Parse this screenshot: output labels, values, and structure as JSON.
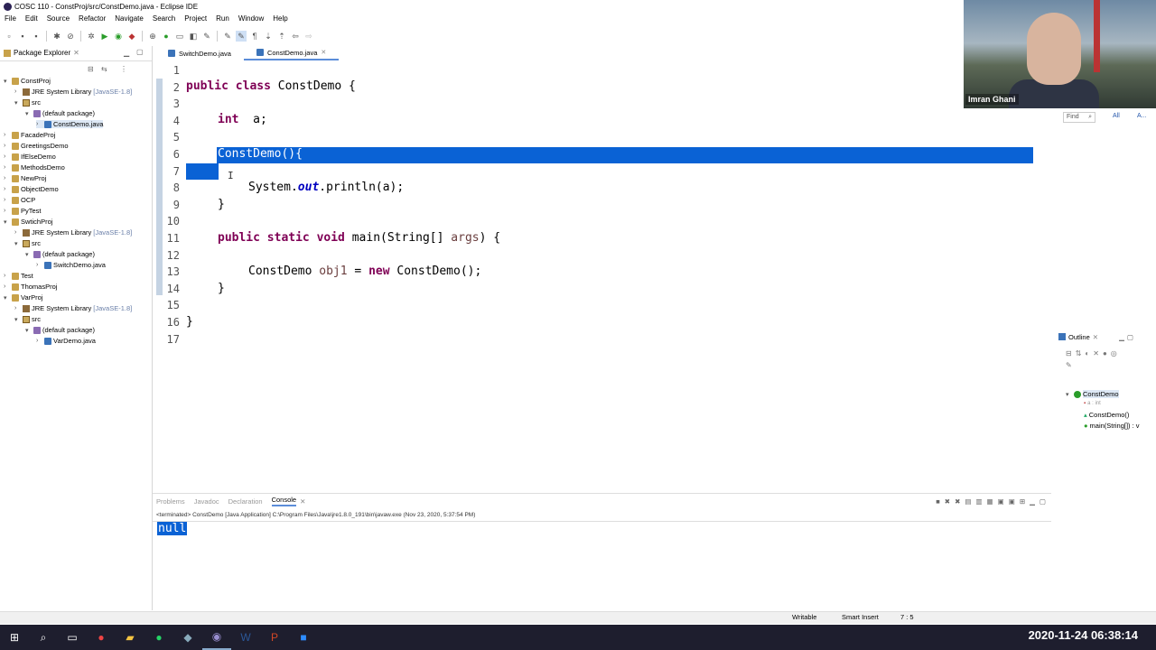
{
  "window": {
    "title": "COSC 110 - ConstProj/src/ConstDemo.java - Eclipse IDE"
  },
  "menu": [
    "File",
    "Edit",
    "Source",
    "Refactor",
    "Navigate",
    "Search",
    "Project",
    "Run",
    "Window",
    "Help"
  ],
  "package_explorer": {
    "title": "Package Explorer",
    "items": [
      {
        "label": "ConstProj",
        "extra": ""
      },
      {
        "label": "JRE System Library",
        "extra": "[JavaSE-1.8]"
      },
      {
        "label": "src",
        "extra": ""
      },
      {
        "label": "(default package)",
        "extra": ""
      },
      {
        "label": "ConstDemo.java",
        "extra": ""
      },
      {
        "label": "FacadeProj",
        "extra": ""
      },
      {
        "label": "GreetingsDemo",
        "extra": ""
      },
      {
        "label": "IfElseDemo",
        "extra": ""
      },
      {
        "label": "MethodsDemo",
        "extra": ""
      },
      {
        "label": "NewProj",
        "extra": ""
      },
      {
        "label": "ObjectDemo",
        "extra": ""
      },
      {
        "label": "OCP",
        "extra": ""
      },
      {
        "label": "PyTest",
        "extra": ""
      },
      {
        "label": "SwtichProj",
        "extra": ""
      },
      {
        "label": "JRE System Library",
        "extra": "[JavaSE-1.8]"
      },
      {
        "label": "src",
        "extra": ""
      },
      {
        "label": "(default package)",
        "extra": ""
      },
      {
        "label": "SwitchDemo.java",
        "extra": ""
      },
      {
        "label": "Test",
        "extra": ""
      },
      {
        "label": "ThomasProj",
        "extra": ""
      },
      {
        "label": "VarProj",
        "extra": ""
      },
      {
        "label": "JRE System Library",
        "extra": "[JavaSE-1.8]"
      },
      {
        "label": "src",
        "extra": ""
      },
      {
        "label": "(default package)",
        "extra": ""
      },
      {
        "label": "VarDemo.java",
        "extra": ""
      }
    ]
  },
  "editor": {
    "tabs": [
      "SwitchDemo.java",
      "ConstDemo.java"
    ],
    "line_numbers": [
      "1",
      "2",
      "3",
      "4",
      "5",
      "6",
      "7",
      "8",
      "9",
      "10",
      "11",
      "12",
      "13",
      "14",
      "15",
      "16",
      "17"
    ],
    "code": {
      "l2_kw": "public class",
      "l2_rest": " ConstDemo {",
      "l4_kw": "int",
      "l4_rest": "  a;",
      "l6": "ConstDemo(){",
      "l8_a": "System.",
      "l8_b": "out",
      "l8_c": ".println(a);",
      "l9": "}",
      "l11_kw": "public static void",
      "l11_rest": " main(String[] ",
      "l11_var": "args",
      "l11_end": ") {",
      "l13_a": "ConstDemo ",
      "l13_var": "obj1",
      "l13_b": " = ",
      "l13_kw": "new",
      "l13_c": " ConstDemo();",
      "l14": "}",
      "l16": "}"
    }
  },
  "video": {
    "participant": "Imran Ghani"
  },
  "find": {
    "placeholder": "Find",
    "all": "All",
    "a": "A..."
  },
  "outline": {
    "title": "Outline",
    "items": [
      "ConstDemo",
      "a : int",
      "ConstDemo()",
      "main(String[]) : v"
    ]
  },
  "console": {
    "tabs": [
      "Problems",
      "Javadoc",
      "Declaration",
      "Console"
    ],
    "status": "<terminated> ConstDemo [Java Application] C:\\Program Files\\Java\\jre1.8.0_191\\bin\\javaw.exe (Nov 23, 2020, 5:37:54 PM)",
    "output": "null"
  },
  "statusbar": {
    "writable": "Writable",
    "insert": "Smart Insert",
    "position": "7 : 5"
  },
  "taskbar": {
    "clock": "2020-11-24  06:38:14"
  }
}
